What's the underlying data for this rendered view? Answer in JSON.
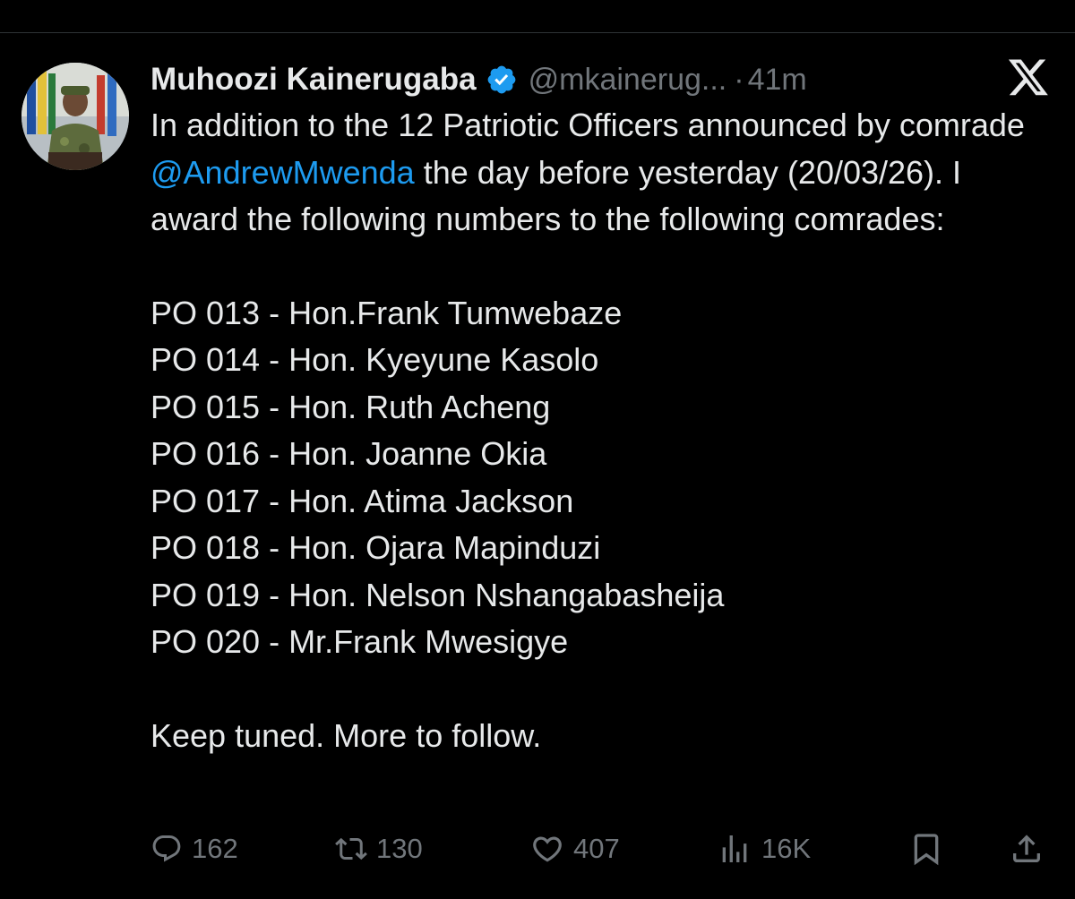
{
  "tweet": {
    "author_name": "Muhoozi Kainerugaba",
    "handle": "@mkainerug...",
    "separator": "·",
    "time": "41m",
    "intro_before": "In addition to the 12 Patriotic Officers announced by comrade ",
    "mention": "@AndrewMwenda",
    "intro_after": " the day before yesterday (20/03/26). I award the following numbers to the following comrades:",
    "list": [
      "PO 013 - Hon.Frank Tumwebaze",
      "PO 014 - Hon. Kyeyune Kasolo",
      "PO 015 - Hon. Ruth Acheng",
      "PO 016 - Hon. Joanne Okia",
      "PO 017 - Hon. Atima Jackson",
      "PO 018 - Hon. Ojara Mapinduzi",
      "PO 019 - Hon. Nelson Nshangabasheija",
      "PO 020 - Mr.Frank Mwesigye"
    ],
    "closing": "Keep tuned. More to follow."
  },
  "actions": {
    "replies": "162",
    "reposts": "130",
    "likes": "407",
    "views": "16K"
  },
  "icons": {
    "avatar": "profile-photo",
    "verified": "verified-badge-icon",
    "brand": "x-logo-icon",
    "reply": "reply-icon",
    "repost": "repost-icon",
    "like": "heart-icon",
    "views": "views-icon",
    "bookmark": "bookmark-icon",
    "share": "share-icon"
  },
  "colors": {
    "background": "#000000",
    "text": "#e7e9ea",
    "muted": "#71767b",
    "accent": "#1d9bf0"
  }
}
